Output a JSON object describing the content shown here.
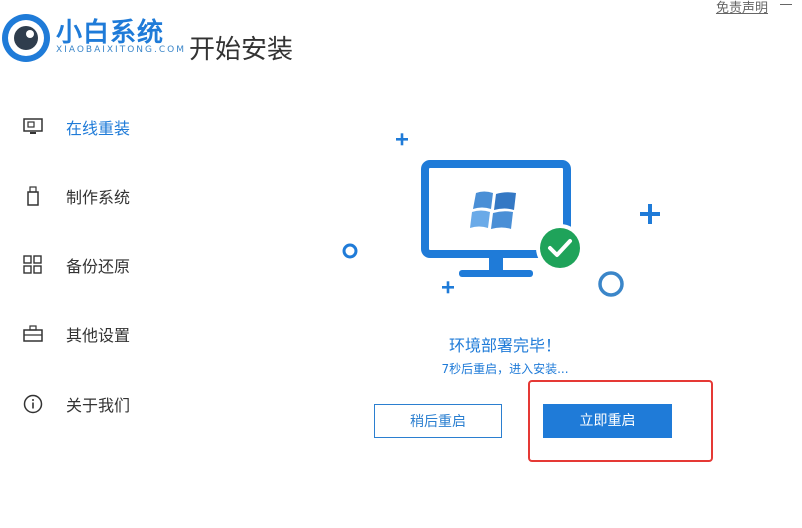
{
  "brand": {
    "name": "小白系统",
    "sub": "XIAOBAIXITONG.COM"
  },
  "page_title": "开始安装",
  "top_right": {
    "disclaimer": "免责声明"
  },
  "sidebar": {
    "items": [
      {
        "label": "在线重装",
        "icon": "monitor-icon",
        "active": true
      },
      {
        "label": "制作系统",
        "icon": "usb-icon",
        "active": false
      },
      {
        "label": "备份还原",
        "icon": "backup-grid-icon",
        "active": false
      },
      {
        "label": "其他设置",
        "icon": "briefcase-icon",
        "active": false
      },
      {
        "label": "关于我们",
        "icon": "info-icon",
        "active": false
      }
    ]
  },
  "main": {
    "status": "环境部署完毕！",
    "countdown": "7秒后重启，进入安装...",
    "later_button": "稍后重启",
    "now_button": "立即重启"
  },
  "colors": {
    "accent": "#1f7bd8",
    "success": "#1fa35a",
    "highlight": "#e53935"
  }
}
